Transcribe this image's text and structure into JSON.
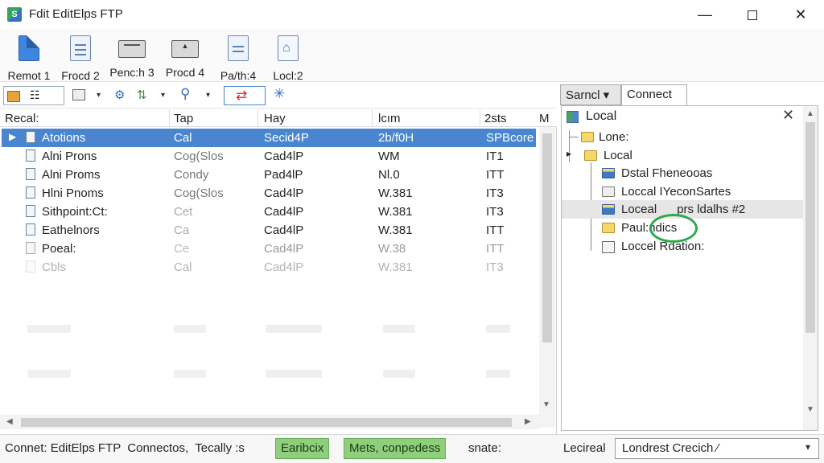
{
  "window": {
    "app_icon_text": "S",
    "title": "Fdit EditElps FTP",
    "min_glyph": "—",
    "close_glyph": "✕"
  },
  "ribbon": {
    "buttons": [
      {
        "label": "Remot 1",
        "icon": "blue-document-icon"
      },
      {
        "label": "Frocd 2",
        "icon": "document-lines-icon"
      },
      {
        "label": "Penc:h 3",
        "icon": "tray-icon"
      },
      {
        "label": "Procd 4",
        "icon": "upload-tray-icon"
      },
      {
        "label": "Pa/th:4",
        "icon": "text-document-icon"
      },
      {
        "label": "Locl:2",
        "icon": "home-document-icon"
      }
    ]
  },
  "toolbar": {
    "glyphs": {
      "list": "☷",
      "dropdown": "▾",
      "connect": "⚙",
      "filter": "⇅",
      "search": "⚲",
      "sync": "⇄",
      "settings": "✳"
    }
  },
  "remote_table": {
    "columns": [
      "Recal:",
      "Tap",
      "Hay",
      "lcım",
      "2sts",
      "M"
    ],
    "rows": [
      {
        "name": "Atotions",
        "type": "Cal",
        "host": "Secid4P",
        "size": "2b/f0H",
        "status": "SPBcore",
        "selected": true,
        "expander": "▶"
      },
      {
        "name": "Alni Prons",
        "type": "Cog(Slos",
        "host": "Cad4lP",
        "size": "WM",
        "status": "IT1"
      },
      {
        "name": "Alni Proms",
        "type": "Condy",
        "host": "Pad4lP",
        "size": "Nl.0",
        "status": "ITT"
      },
      {
        "name": "Hlni Pnoms",
        "type": "Cog(Slos",
        "host": "Cad4lP",
        "size": "W.381",
        "status": "IT3"
      },
      {
        "name": "Sithpoint:Ct:",
        "type": "Cet",
        "host": "Cad4lP",
        "size": "W.381",
        "status": "IT3"
      },
      {
        "name": "Eathelnors",
        "type": "Ca",
        "host": "Cad4lP",
        "size": "W.381",
        "status": "ITT"
      },
      {
        "name": "Poeal:",
        "type": "Ce",
        "host": "Cad4lP",
        "size": "W.38",
        "status": "ITT"
      },
      {
        "name": "Cbls",
        "type": "Cal",
        "host": "Cad4lP",
        "size": "W.381",
        "status": "IT3"
      }
    ]
  },
  "right_panel": {
    "tabs": [
      "Sarncl ▾",
      "Connect"
    ],
    "header": "Local",
    "close_glyph": "✕",
    "expander": "▸",
    "tree": [
      {
        "label": "Lone:",
        "icon": "folder-icon"
      },
      {
        "label": "Local",
        "icon": "folder-icon"
      },
      {
        "label": "Dstal Fheneooas",
        "icon": "blue-folder-icon"
      },
      {
        "label": "Loccal IYeconSartes",
        "icon": "grey-folder-icon"
      },
      {
        "label": "Loceal      prs ldalhs #2",
        "icon": "blue-folder-icon",
        "highlight": true
      },
      {
        "label": "Paul:ndics",
        "icon": "folder-icon"
      },
      {
        "label": "Loccel Rdation:",
        "icon": "file-icon"
      }
    ]
  },
  "status_bar": {
    "text1": "Connet: EditElps FTP  Connectos,  Tecally :s",
    "badge1": "Earibcix",
    "badge2": "Mets, conpedess",
    "text2": "snate:",
    "text3": "Lecireal",
    "combo_value": "Londrest Crecich ⁄",
    "combo_arrow": "▾"
  },
  "colors": {
    "selection": "#4a86cf",
    "status_badge": "#8fce7d",
    "annotation_circle": "#2da84a"
  }
}
